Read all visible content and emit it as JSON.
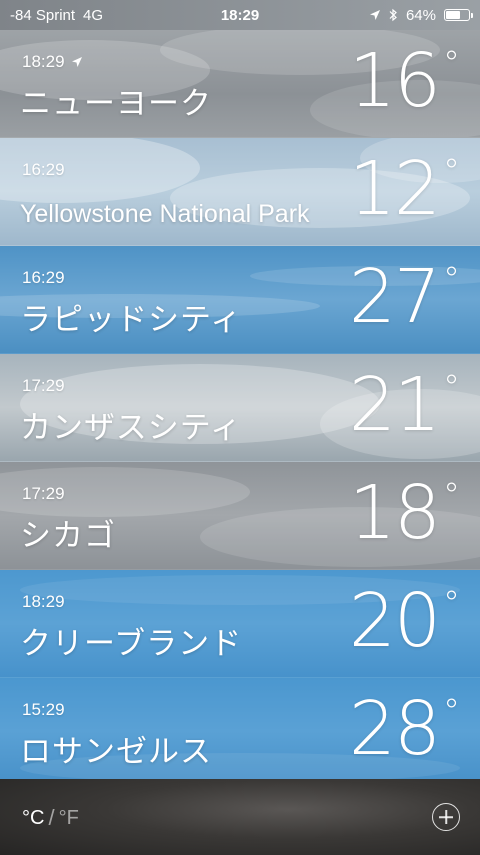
{
  "status_bar": {
    "carrier": "-84 Sprint",
    "network": "4G",
    "time": "18:29",
    "battery": "64%",
    "battery_level": 0.64
  },
  "cities": [
    {
      "time": "18:29",
      "location_arrow": true,
      "name": "ニューヨーク",
      "temp": "16"
    },
    {
      "time": "16:29",
      "location_arrow": false,
      "name": "Yellowstone National Park",
      "temp": "12"
    },
    {
      "time": "16:29",
      "location_arrow": false,
      "name": "ラピッドシティ",
      "temp": "27"
    },
    {
      "time": "17:29",
      "location_arrow": false,
      "name": "カンザスシティ",
      "temp": "21"
    },
    {
      "time": "17:29",
      "location_arrow": false,
      "name": "シカゴ",
      "temp": "18"
    },
    {
      "time": "18:29",
      "location_arrow": false,
      "name": "クリーブランド",
      "temp": "20"
    },
    {
      "time": "15:29",
      "location_arrow": false,
      "name": "ロサンゼルス",
      "temp": "28"
    }
  ],
  "degree_symbol": "°",
  "footer": {
    "unit_c": "°C",
    "unit_sep": "/",
    "unit_f": "°F"
  }
}
